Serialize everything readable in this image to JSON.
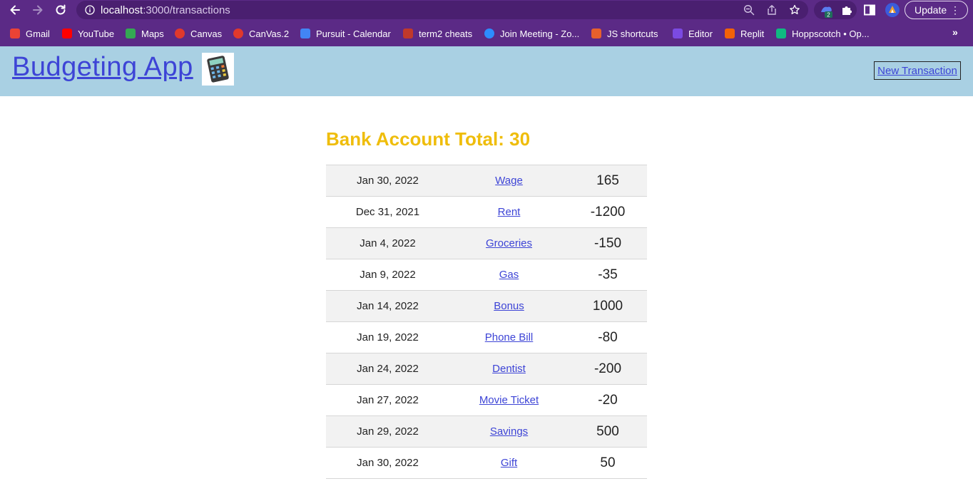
{
  "browser": {
    "url_host": "localhost",
    "url_path": ":3000/transactions",
    "update_label": "Update",
    "extension_badge": "2",
    "bookmarks": [
      {
        "label": "Gmail",
        "icon": "gmail-icon"
      },
      {
        "label": "YouTube",
        "icon": "youtube-icon"
      },
      {
        "label": "Maps",
        "icon": "maps-icon"
      },
      {
        "label": "Canvas",
        "icon": "canvas-icon"
      },
      {
        "label": "CanVas.2",
        "icon": "canvas-icon"
      },
      {
        "label": "Pursuit - Calendar",
        "icon": "calendar-icon"
      },
      {
        "label": "term2 cheats",
        "icon": "term-icon"
      },
      {
        "label": "Join Meeting - Zo...",
        "icon": "zoom-icon"
      },
      {
        "label": "JS shortcuts",
        "icon": "box-icon"
      },
      {
        "label": "Editor",
        "icon": "editor-icon"
      },
      {
        "label": "Replit",
        "icon": "replit-icon"
      },
      {
        "label": "Hoppscotch • Op...",
        "icon": "hoppscotch-icon"
      }
    ],
    "bookmarks_more": "»"
  },
  "app": {
    "title": "Budgeting App",
    "new_transaction_label": "New Transaction",
    "total_label": "Bank Account Total: 30"
  },
  "transactions": [
    {
      "date": "Jan 30, 2022",
      "name": "Wage",
      "amount": "165"
    },
    {
      "date": "Dec 31, 2021",
      "name": "Rent",
      "amount": "-1200"
    },
    {
      "date": "Jan 4, 2022",
      "name": "Groceries",
      "amount": "-150"
    },
    {
      "date": "Jan 9, 2022",
      "name": "Gas",
      "amount": "-35"
    },
    {
      "date": "Jan 14, 2022",
      "name": "Bonus",
      "amount": "1000"
    },
    {
      "date": "Jan 19, 2022",
      "name": "Phone Bill",
      "amount": "-80"
    },
    {
      "date": "Jan 24, 2022",
      "name": "Dentist",
      "amount": "-200"
    },
    {
      "date": "Jan 27, 2022",
      "name": "Movie Ticket",
      "amount": "-20"
    },
    {
      "date": "Jan 29, 2022",
      "name": "Savings",
      "amount": "500"
    },
    {
      "date": "Jan 30, 2022",
      "name": "Gift",
      "amount": "50"
    }
  ],
  "colors": {
    "chrome_bg": "#5b2a86",
    "header_bg": "#a9d0e3",
    "link": "#3d44d6",
    "total": "#efbd0b"
  }
}
